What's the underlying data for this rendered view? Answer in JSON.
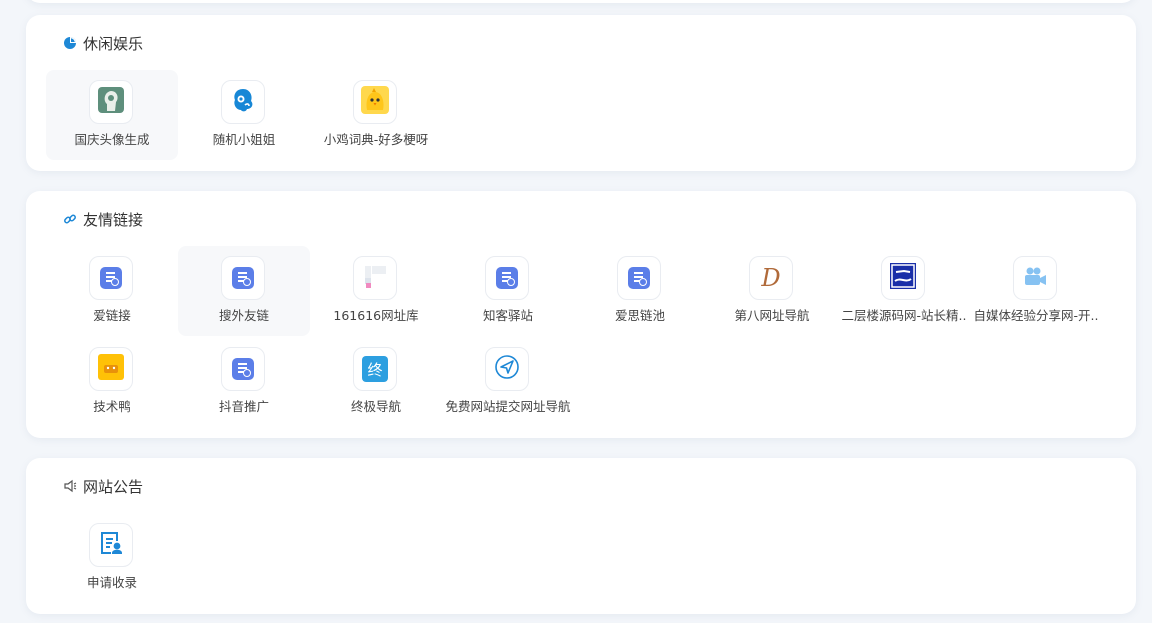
{
  "sections": {
    "leisure": {
      "title": "休闲娱乐",
      "items": [
        {
          "label": "国庆头像生成",
          "icon": "avatar-silhouette-icon"
        },
        {
          "label": "随机小姐姐",
          "icon": "girl-head-icon"
        },
        {
          "label": "小鸡词典-好多梗呀",
          "icon": "chick-icon"
        }
      ]
    },
    "friends": {
      "title": "友情链接",
      "items": [
        {
          "label": "爱链接",
          "icon": "document-icon"
        },
        {
          "label": "搜外友链",
          "icon": "document-icon"
        },
        {
          "label": "161616网址库",
          "icon": "pixel-logo-icon"
        },
        {
          "label": "知客驿站",
          "icon": "document-icon"
        },
        {
          "label": "爱思链池",
          "icon": "document-icon"
        },
        {
          "label": "第八网址导航",
          "icon": "letter-d-icon",
          "glyph": "D"
        },
        {
          "label": "二层楼源码网-站长精..",
          "icon": "blue-box-logo-icon"
        },
        {
          "label": "自媒体经验分享网-开..",
          "icon": "video-camera-icon"
        },
        {
          "label": "技术鸭",
          "icon": "duck-icon"
        },
        {
          "label": "抖音推广",
          "icon": "document-icon"
        },
        {
          "label": "终极导航",
          "icon": "zhong-char-icon",
          "glyph": "终"
        },
        {
          "label": "免费网站提交网址导航",
          "icon": "paper-plane-icon"
        }
      ]
    },
    "notice": {
      "title": "网站公告",
      "items": [
        {
          "label": "申请收录",
          "icon": "apply-form-icon"
        }
      ]
    }
  },
  "colors": {
    "background": "#f3f6fa",
    "card": "#ffffff",
    "accent_blue": "#1e88d6",
    "doc_icon": "#5b7ee8"
  }
}
